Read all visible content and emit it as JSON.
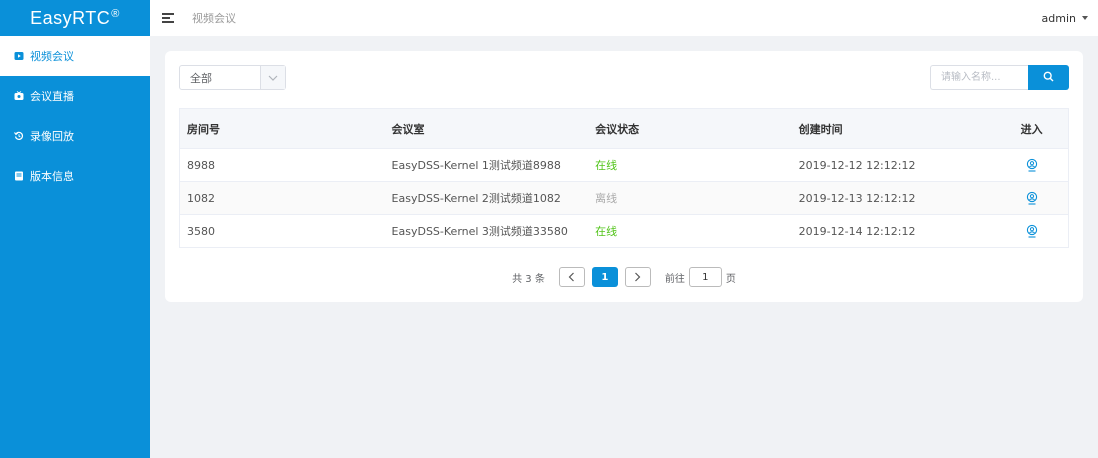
{
  "sidebar": {
    "logo": "EasyRTC",
    "logo_mark": "®",
    "items": [
      {
        "label": "视频会议",
        "icon": "video-icon"
      },
      {
        "label": "会议直播",
        "icon": "live-icon"
      },
      {
        "label": "录像回放",
        "icon": "replay-icon"
      },
      {
        "label": "版本信息",
        "icon": "info-icon"
      }
    ]
  },
  "header": {
    "breadcrumb": "视频会议",
    "user": "admin"
  },
  "filter": {
    "selected": "全部"
  },
  "search": {
    "placeholder": "请输入名称..."
  },
  "table": {
    "columns": [
      "房间号",
      "会议室",
      "会议状态",
      "创建时间",
      "进入"
    ],
    "rows": [
      {
        "room": "8988",
        "name": "EasyDSS-Kernel 1测试频道8988",
        "status": "在线",
        "created": "2019-12-12 12:12:12"
      },
      {
        "room": "1082",
        "name": "EasyDSS-Kernel 2测试频道1082",
        "status": "离线",
        "created": "2019-12-13 12:12:12"
      },
      {
        "room": "3580",
        "name": "EasyDSS-Kernel 3测试频道33580",
        "status": "在线",
        "created": "2019-12-14 12:12:12"
      }
    ]
  },
  "pagination": {
    "total": "共 3 条",
    "current": "1",
    "goto_prefix": "前往",
    "goto_value": "1",
    "goto_suffix": "页"
  },
  "colors": {
    "accent": "#0a90d9",
    "online": "#52c41a",
    "offline": "#aaaaaa"
  }
}
